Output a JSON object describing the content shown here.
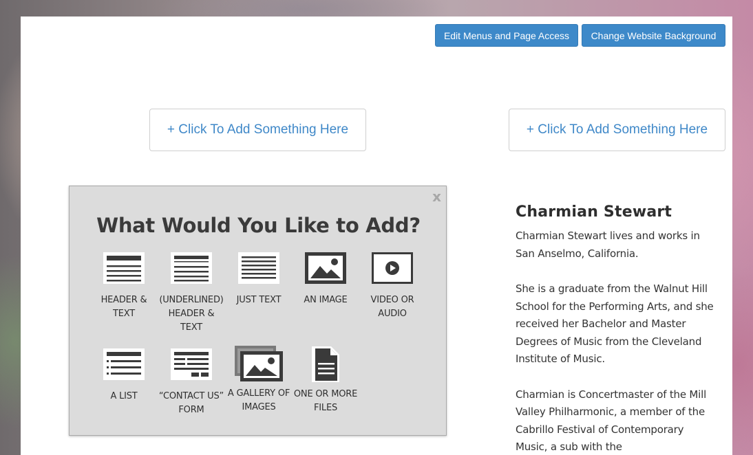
{
  "toolbar": {
    "edit_menus_label": "Edit Menus and Page Access",
    "change_background_label": "Change Website Background"
  },
  "add_left_label": "+ Click To Add Something Here",
  "add_right_label": "+ Click To Add Something Here",
  "modal": {
    "close_label": "x",
    "title": "What Would You Like to Add?",
    "options": [
      {
        "icon": "header-text-icon",
        "label": "Header & Text"
      },
      {
        "icon": "underlined-header-text-icon",
        "label": "(Underlined) Header & Text"
      },
      {
        "icon": "just-text-icon",
        "label": "Just Text"
      },
      {
        "icon": "image-icon",
        "label": "An Image"
      },
      {
        "icon": "video-audio-icon",
        "label": "Video or Audio"
      },
      {
        "icon": "list-icon",
        "label": "A List"
      },
      {
        "icon": "contact-form-icon",
        "label": "“Contact Us” Form"
      },
      {
        "icon": "gallery-icon",
        "label": "A Gallery of Images"
      },
      {
        "icon": "files-icon",
        "label": "One or More Files"
      }
    ]
  },
  "bio": {
    "name": "Charmian Stewart",
    "paragraphs": [
      "Charmian Stewart lives and works in San Anselmo, California.",
      "She is a graduate from the Walnut Hill School for the Performing Arts, and she received her Bachelor and Master Degrees of Music from the Cleveland Institute of Music.",
      "Charmian is Concertmaster of the Mill Valley Philharmonic, a member of the Cabrillo Festival of Contemporary Music, a sub with the"
    ]
  },
  "colors": {
    "button_blue": "#3d89c9",
    "link_blue": "#3f88c8",
    "modal_bg": "#dcdcdc",
    "icon_dark": "#3a3a3a"
  }
}
